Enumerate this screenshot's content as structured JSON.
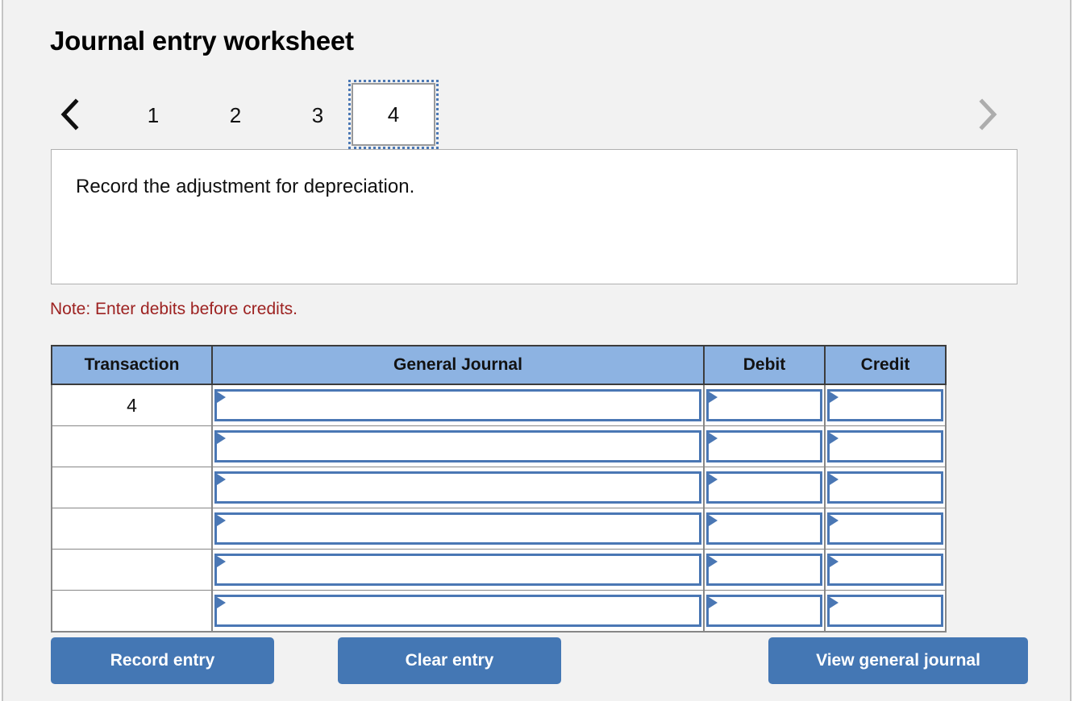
{
  "page": {
    "title": "Journal entry worksheet",
    "background_color": "#f2f2f2"
  },
  "tab_nav": {
    "prev_icon": "chevron-left-icon",
    "next_icon": "chevron-right-icon",
    "prev_enabled_color": "#111111",
    "next_enabled_color": "#adadad",
    "tabs": [
      {
        "label": "1",
        "active": false
      },
      {
        "label": "2",
        "active": false
      },
      {
        "label": "3",
        "active": false
      },
      {
        "label": "4",
        "active": true
      }
    ],
    "active_tab": "4"
  },
  "prompt": {
    "text": "Record the adjustment for depreciation."
  },
  "note": {
    "text": "Note: Enter debits before credits.",
    "color": "#9d2221"
  },
  "journal_table": {
    "headers": [
      "Transaction",
      "General Journal",
      "Debit",
      "Credit"
    ],
    "header_bg": "#8db3e2",
    "input_border_color": "#4a77b4",
    "rows": [
      {
        "transaction": "4",
        "general_journal": "",
        "debit": "",
        "credit": ""
      },
      {
        "transaction": "",
        "general_journal": "",
        "debit": "",
        "credit": ""
      },
      {
        "transaction": "",
        "general_journal": "",
        "debit": "",
        "credit": ""
      },
      {
        "transaction": "",
        "general_journal": "",
        "debit": "",
        "credit": ""
      },
      {
        "transaction": "",
        "general_journal": "",
        "debit": "",
        "credit": ""
      },
      {
        "transaction": "",
        "general_journal": "",
        "debit": "",
        "credit": ""
      }
    ]
  },
  "buttons": {
    "record": "Record entry",
    "clear": "Clear entry",
    "view": "View general journal",
    "color": "#4477b4"
  }
}
